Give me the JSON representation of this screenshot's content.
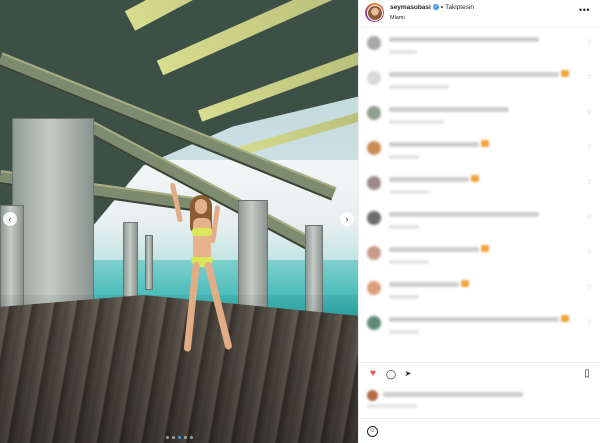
{
  "post": {
    "username": "seymasubasi",
    "separator": "•",
    "follow_label": "Takiptesin",
    "location": "Miami",
    "more_glyph": "•••",
    "verified_icon": "verified-badge-icon",
    "slide_count": 5,
    "active_slide": 2
  },
  "comments": [
    {
      "avatar_color": "#a9a9a9",
      "text": "",
      "emoji": false
    },
    {
      "avatar_color": "#d9d9d9",
      "text": "",
      "emoji": true
    },
    {
      "avatar_color": "#8f9e8e",
      "text": "",
      "emoji": false
    },
    {
      "avatar_color": "#c98c55",
      "text": "",
      "emoji": true
    },
    {
      "avatar_color": "#9a8a8a",
      "text": "",
      "emoji": true
    },
    {
      "avatar_color": "#6d6d6d",
      "text": "",
      "emoji": false
    },
    {
      "avatar_color": "#c79a8a",
      "text": "",
      "emoji": true
    },
    {
      "avatar_color": "#d9a07a",
      "text": "",
      "emoji": true
    },
    {
      "avatar_color": "#5f8a78",
      "text": "",
      "emoji": true
    }
  ],
  "actions": {
    "like_icon": "heart-icon",
    "comment_icon": "comment-icon",
    "share_icon": "share-icon",
    "save_icon": "bookmark-icon",
    "like_glyph": "♥",
    "comment_glyph": "◯",
    "share_glyph": "➤",
    "save_glyph": "▯"
  },
  "add_comment": {
    "placeholder": "",
    "post_label": "",
    "emoji_glyph": "☺"
  },
  "colors": {
    "accent": "#3897f0",
    "like": "#ed4956",
    "story_ring": [
      "#f58529",
      "#dd2a7b",
      "#8134af"
    ]
  }
}
